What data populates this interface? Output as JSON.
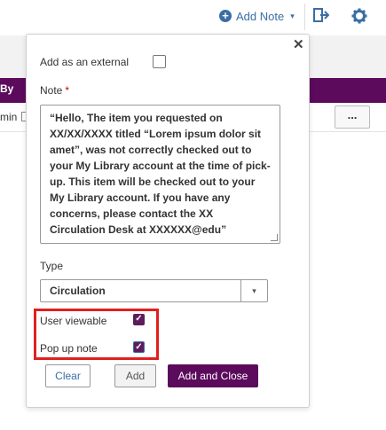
{
  "toolbar": {
    "add_note_label": "Add Note",
    "plus_icon_glyph": "+",
    "caret_glyph": "▾"
  },
  "background": {
    "column_header": "By",
    "row_text": "min",
    "more_label": "..."
  },
  "popup": {
    "close_glyph": "✕",
    "external_label": "Add as an external",
    "external_checked": false,
    "note_label": "Note",
    "required_mark": "*",
    "note_value": "“Hello, The item you requested on XX/XX/XXXX titled “Lorem ipsum dolor sit amet”, was not correctly checked out to your My Library account at the time of pick-up. This item will be checked out to your My Library account. If you have any concerns, please contact the XX Circulation Desk at XXXXXX@edu”",
    "type_label": "Type",
    "type_value": "Circulation",
    "type_caret": "▾",
    "user_viewable_label": "User viewable",
    "user_viewable_checked": true,
    "pop_up_label": "Pop up note",
    "pop_up_checked": true,
    "check_glyph": "✓",
    "clear_label": "Clear",
    "add_label": "Add",
    "add_close_label": "Add and Close"
  },
  "colors": {
    "accent_purple": "#5c0a5c",
    "link_blue": "#3a6ea5",
    "highlight_red": "#e0201f"
  }
}
